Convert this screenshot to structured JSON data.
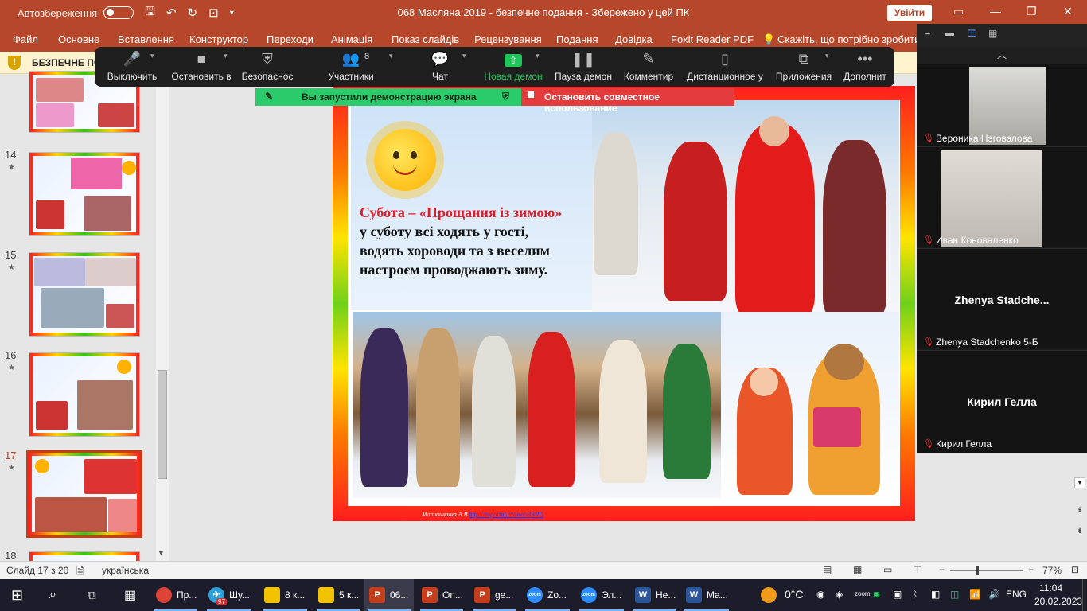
{
  "titlebar": {
    "autosave_label": "Автозбереження",
    "doc_title": "068 Масляна 2019  -  безпечне подання  -  Збережено у цей ПК",
    "signin_label": "Увійти"
  },
  "ribbon": {
    "tabs": [
      "Файл",
      "Основне",
      "Вставлення",
      "Конструктор",
      "Переходи",
      "Анімація",
      "Показ слайдів",
      "Рецензування",
      "Подання",
      "Довідка",
      "Foxit Reader PDF",
      "Скажіть, що потрібно зробити"
    ]
  },
  "protected_bar": {
    "text": "БЕЗПЕЧНЕ ПО"
  },
  "thumbnails": [
    {
      "number": "14"
    },
    {
      "number": "15"
    },
    {
      "number": "16"
    },
    {
      "number": "17"
    },
    {
      "number": "18"
    }
  ],
  "zoom_toolbar": {
    "mute": "Выключить",
    "video": "Остановить в",
    "security": "Безопаснос",
    "participants": "Участники",
    "participants_count": "8",
    "chat": "Чат",
    "share": "Новая демон",
    "pause": "Пауза демон",
    "annotate": "Комментир",
    "remote": "Дистанционное у",
    "apps": "Приложения",
    "more": "Дополнит"
  },
  "share_bar": {
    "green_text": "Вы запустили демонстрацию экрана",
    "red_text": "Остановить совместное использование"
  },
  "slide": {
    "heading": "Субота –  «Прощання із зимою»",
    "lines": [
      "у суботу всі ходять у гості,",
      "водять хороводи та з веселим",
      "настроєм проводжають зиму."
    ],
    "footer_author": "Матюшкина А.В",
    "footer_link": "http://nsportal.ru/user/33485"
  },
  "gallery": {
    "participants": [
      {
        "name": "Вероника Нэговэлова"
      },
      {
        "name": "Иван Коноваленко"
      },
      {
        "name": "Zhenya Stadchenko 5-Б",
        "big": "Zhenya  Stadche..."
      },
      {
        "name": "Кирил Гелла",
        "big": "Кирил Гелла"
      }
    ]
  },
  "statusbar": {
    "slide_info": "Слайд 17 з 20",
    "language": "українська",
    "zoom_level": "77%"
  },
  "taskbar": {
    "apps": [
      {
        "label": "Пр...",
        "icon": "chrome-icon",
        "color": "#db4437"
      },
      {
        "label": "Шу...",
        "icon": "telegram-icon",
        "color": "#2aa1da",
        "badge": "97"
      },
      {
        "label": "8 к...",
        "icon": "folder-icon",
        "color": "#f2c200"
      },
      {
        "label": "5 к...",
        "icon": "folder-icon",
        "color": "#f2c200"
      },
      {
        "label": "06...",
        "icon": "powerpoint-icon",
        "color": "#c43e1c"
      },
      {
        "label": "Оп...",
        "icon": "powerpoint-icon",
        "color": "#c43e1c"
      },
      {
        "label": "ge...",
        "icon": "powerpoint-icon",
        "color": "#c43e1c"
      },
      {
        "label": "Zo...",
        "icon": "zoom-icon",
        "color": "#2d8cff"
      },
      {
        "label": "Эл...",
        "icon": "zoom-icon",
        "color": "#2d8cff"
      },
      {
        "label": "Не...",
        "icon": "word-icon",
        "color": "#2b579a"
      },
      {
        "label": "Ма...",
        "icon": "word-icon",
        "color": "#2b579a"
      }
    ],
    "temperature": "0°C",
    "language": "ENG",
    "time": "11:04",
    "date": "20.02.2023"
  }
}
